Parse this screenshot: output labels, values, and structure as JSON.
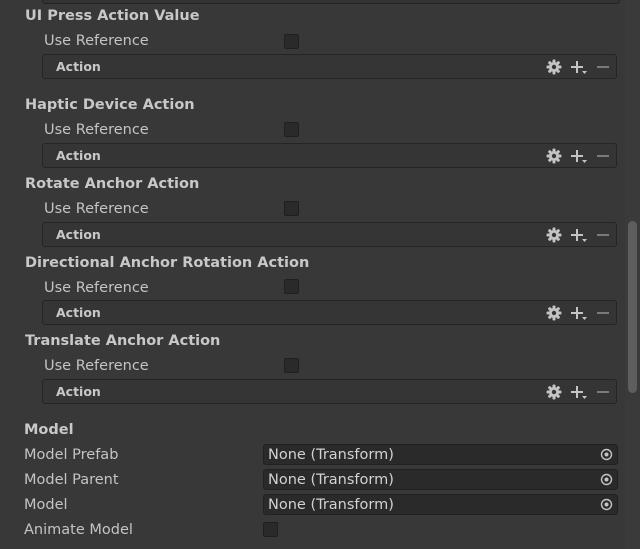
{
  "sections": [
    {
      "title": "UI Press Action Value",
      "use_reference_label": "Use Reference",
      "action_label": "Action"
    },
    {
      "title": "Haptic Device Action",
      "use_reference_label": "Use Reference",
      "action_label": "Action"
    },
    {
      "title": "Rotate Anchor Action",
      "use_reference_label": "Use Reference",
      "action_label": "Action"
    },
    {
      "title": "Directional Anchor Rotation Action",
      "use_reference_label": "Use Reference",
      "action_label": "Action"
    },
    {
      "title": "Translate Anchor Action",
      "use_reference_label": "Use Reference",
      "action_label": "Action"
    }
  ],
  "model": {
    "header": "Model",
    "prefab_label": "Model Prefab",
    "prefab_value": "None (Transform)",
    "parent_label": "Model Parent",
    "parent_value": "None (Transform)",
    "model_label": "Model",
    "model_value": "None (Transform)",
    "animate_label": "Animate Model"
  },
  "icons": {
    "settings": "gear-icon",
    "add": "plus-dropdown-icon",
    "remove": "minus-icon",
    "picker": "object-picker-icon"
  },
  "colors": {
    "background": "#383838",
    "field": "#2a2a2a",
    "text": "#c4c4c4",
    "scroll_thumb": "#5e5e5e"
  }
}
